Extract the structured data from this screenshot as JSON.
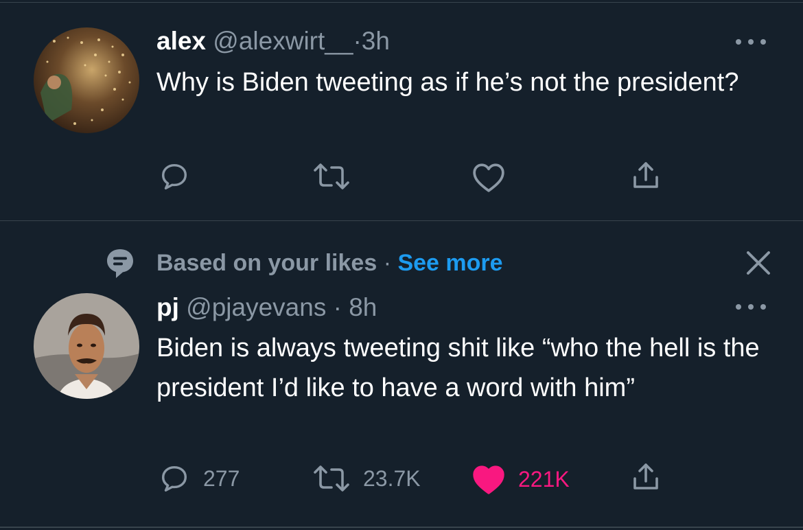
{
  "tweets": [
    {
      "display_name": "alex",
      "handle": "@alexwirt__",
      "separator": "·",
      "time": "3h",
      "text": "Why is Biden tweeting as if he’s not the president?",
      "actions": {
        "replies": "",
        "retweets": "",
        "likes": "",
        "liked": false
      },
      "avatar_icon": "avatar-photo"
    },
    {
      "social_context": {
        "label": "Based on your likes",
        "separator": "·",
        "link": "See more",
        "icon": "chat-bubble-lines-icon"
      },
      "display_name": "pj",
      "handle": "@pjayevans",
      "separator": "·",
      "time": "8h",
      "text": "Biden is always tweeting shit like “who the hell is the president I’d like to have a word with him”",
      "actions": {
        "replies": "277",
        "retweets": "23.7K",
        "likes": "221K",
        "liked": true
      },
      "avatar_icon": "avatar-photo"
    }
  ],
  "icons": {
    "reply": "reply-icon",
    "retweet": "retweet-icon",
    "like": "heart-icon",
    "share": "share-icon",
    "more": "more-icon",
    "close": "close-icon"
  },
  "colors": {
    "background": "#15202b",
    "divider": "#38444d",
    "secondary_text": "#8b98a5",
    "accent_blue": "#1d9bf0",
    "like_pink": "#f91880"
  }
}
